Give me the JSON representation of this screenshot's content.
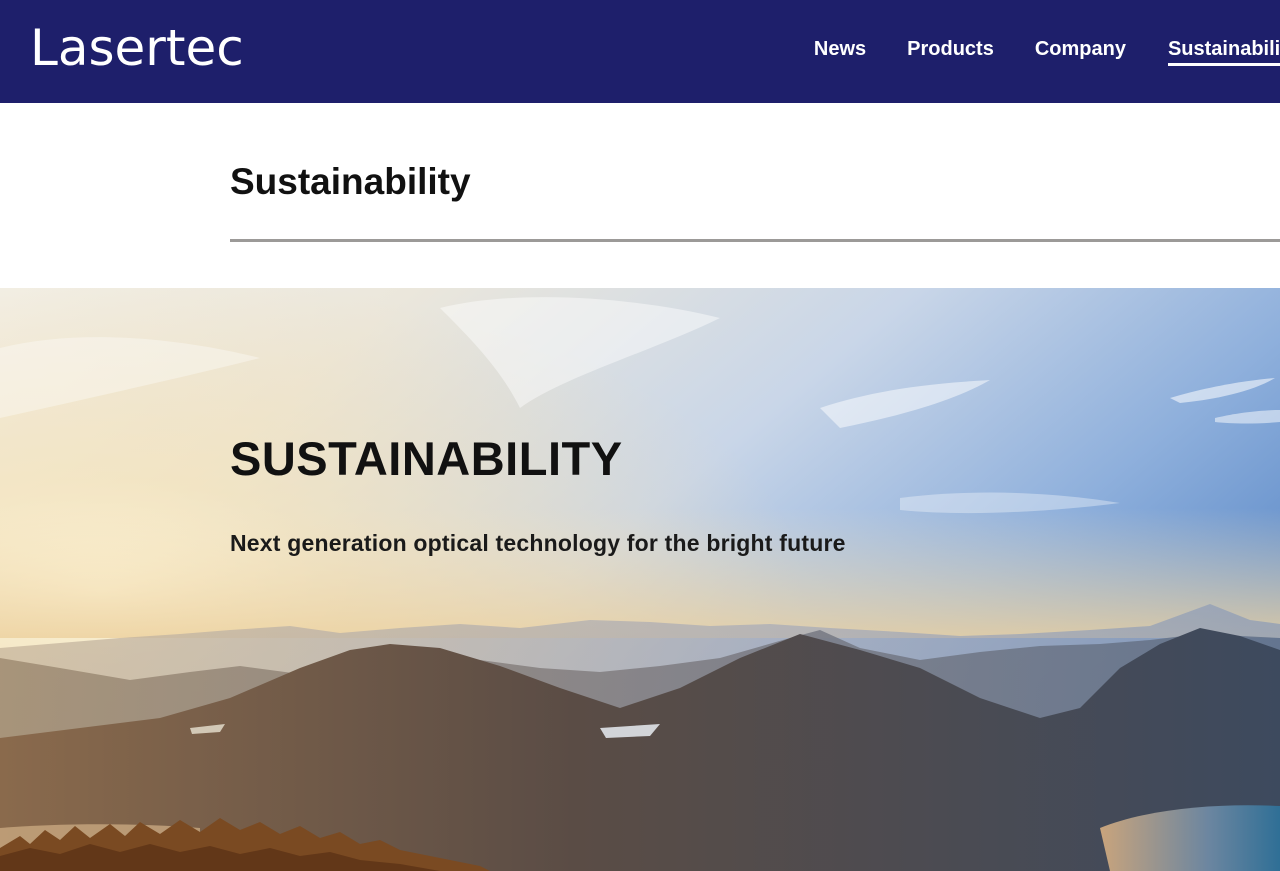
{
  "header": {
    "logo": "Lasertec",
    "brand_color": "#1e1f6b",
    "nav": [
      {
        "label": "News",
        "active": false
      },
      {
        "label": "Products",
        "active": false
      },
      {
        "label": "Company",
        "active": false
      },
      {
        "label": "Sustainability",
        "active": true
      }
    ]
  },
  "main": {
    "page_title": "Sustainability"
  },
  "hero": {
    "title": "SUSTAINABILITY",
    "subtitle": "Next generation optical technology for the bright future"
  }
}
